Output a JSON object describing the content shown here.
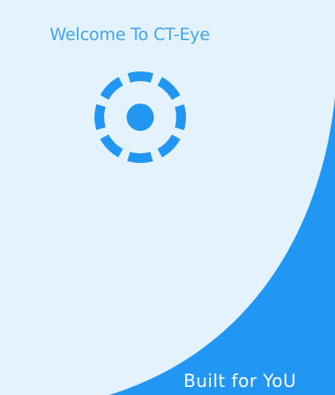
{
  "app": {
    "title": "Welcome To CT-Eye",
    "tagline": "Built for YoU",
    "logo_icon": "camera-focus-icon"
  },
  "colors": {
    "background": "#e3f2fc",
    "accent": "#2196f3",
    "title": "#42a5f5",
    "tagline": "#ffffff"
  }
}
